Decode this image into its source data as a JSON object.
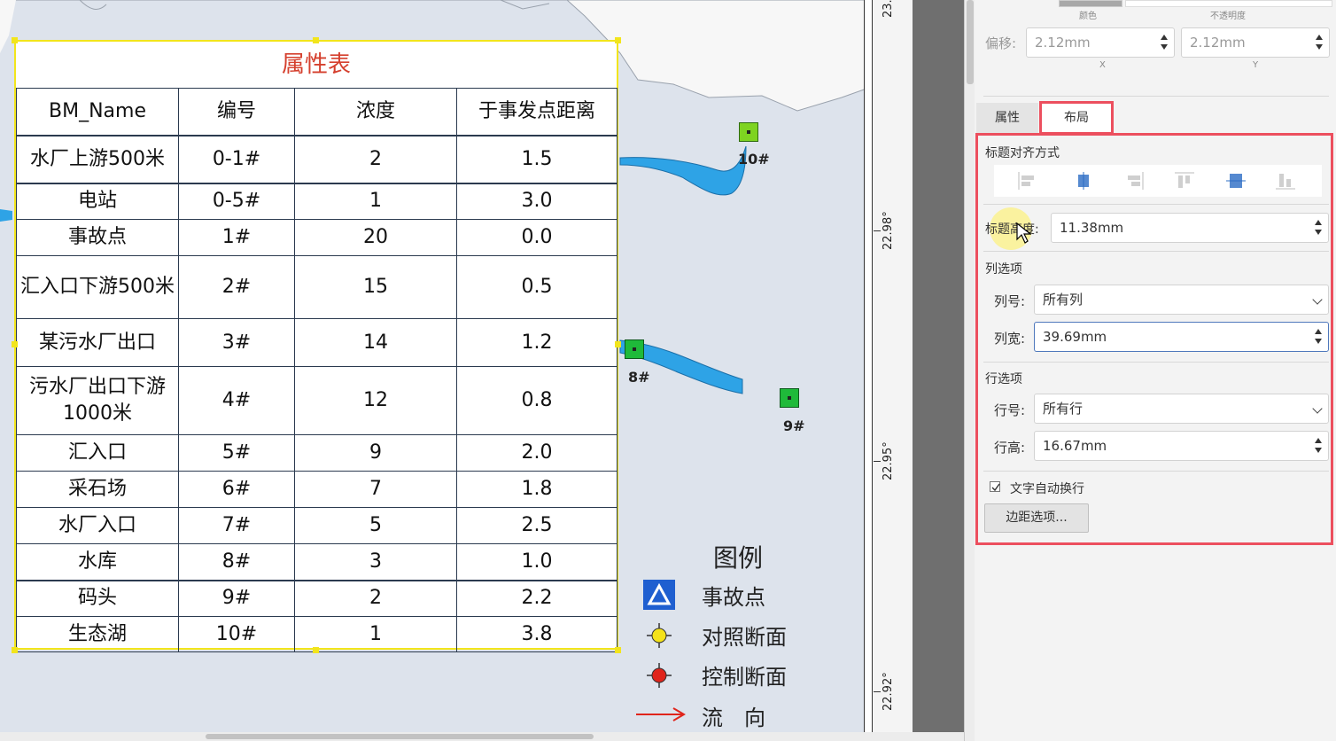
{
  "attr_table": {
    "title": "属性表",
    "columns": [
      "BM_Name",
      "编号",
      "浓度",
      "于事发点距离"
    ],
    "rows": [
      {
        "name": "水厂上游500米",
        "id": "0-1#",
        "conc": "2",
        "dist": "1.5"
      },
      {
        "name": "电站",
        "id": "0-5#",
        "conc": "1",
        "dist": "3.0"
      },
      {
        "name": "事故点",
        "id": "1#",
        "conc": "20",
        "dist": "0.0"
      },
      {
        "name": "汇入口下游500米",
        "id": "2#",
        "conc": "15",
        "dist": "0.5"
      },
      {
        "name": "某污水厂出口",
        "id": "3#",
        "conc": "14",
        "dist": "1.2"
      },
      {
        "name": "污水厂出口下游1000米",
        "id": "4#",
        "conc": "12",
        "dist": "0.8"
      },
      {
        "name": "汇入口",
        "id": "5#",
        "conc": "9",
        "dist": "2.0"
      },
      {
        "name": "采石场",
        "id": "6#",
        "conc": "7",
        "dist": "1.8"
      },
      {
        "name": "水厂入口",
        "id": "7#",
        "conc": "5",
        "dist": "2.5"
      },
      {
        "name": "水库",
        "id": "8#",
        "conc": "3",
        "dist": "1.0"
      },
      {
        "name": "码头",
        "id": "9#",
        "conc": "2",
        "dist": "2.2"
      },
      {
        "name": "生态湖",
        "id": "10#",
        "conc": "1",
        "dist": "3.8"
      }
    ]
  },
  "map": {
    "markers": [
      {
        "label": "10#"
      },
      {
        "label": "8#"
      },
      {
        "label": "9#"
      }
    ],
    "lat_labels": [
      "23.",
      "22.98°",
      "22.95°",
      "22.92°"
    ]
  },
  "legend": {
    "title": "图例",
    "items": [
      {
        "label": "事故点",
        "symbol": "triangle-icon"
      },
      {
        "label": "对照断面",
        "symbol": "crosshair-yellow-icon"
      },
      {
        "label": "控制断面",
        "symbol": "crosshair-red-icon"
      },
      {
        "label": "流　向",
        "symbol": "arrow-right-icon"
      }
    ]
  },
  "panel": {
    "top_labels": {
      "color": "颜色",
      "opacity": "不透明度"
    },
    "offset": {
      "label": "偏移:",
      "x_value": "2.12mm",
      "y_value": "2.12mm",
      "x_caption": "X",
      "y_caption": "Y"
    },
    "tabs": [
      "属性",
      "布局"
    ],
    "active_tab": "布局",
    "title_align_label": "标题对齐方式",
    "title_height": {
      "label": "标题高度:",
      "value": "11.38mm"
    },
    "column_options": {
      "section": "列选项",
      "col_no_label": "列号:",
      "col_no_value": "所有列",
      "col_width_label": "列宽:",
      "col_width_value": "39.69mm"
    },
    "row_options": {
      "section": "行选项",
      "row_no_label": "行号:",
      "row_no_value": "所有行",
      "row_height_label": "行高:",
      "row_height_value": "16.67mm"
    },
    "wrap_text": {
      "label": "文字自动换行",
      "checked": true
    },
    "margin_button": "边距选项...",
    "highlight_color": "#ec4f5e"
  }
}
